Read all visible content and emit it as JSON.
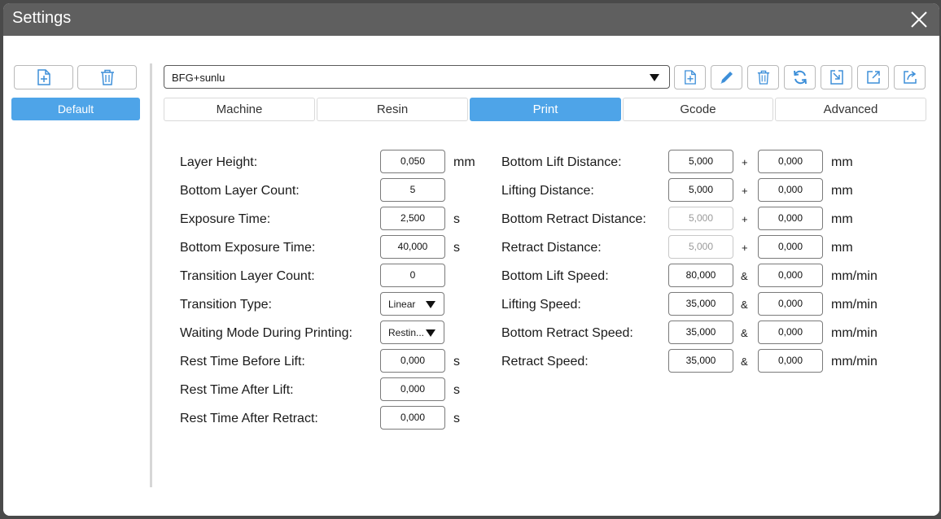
{
  "window": {
    "title": "Settings"
  },
  "profiles": {
    "items": [
      "Default"
    ]
  },
  "machine_dropdown": {
    "value": "BFG+sunlu"
  },
  "tabs": [
    {
      "label": "Machine",
      "active": false
    },
    {
      "label": "Resin",
      "active": false
    },
    {
      "label": "Print",
      "active": true
    },
    {
      "label": "Gcode",
      "active": false
    },
    {
      "label": "Advanced",
      "active": false
    }
  ],
  "left_fields": [
    {
      "label": "Layer Height:",
      "value": "0,050",
      "unit": "mm"
    },
    {
      "label": "Bottom Layer Count:",
      "value": "5",
      "unit": ""
    },
    {
      "label": "Exposure Time:",
      "value": "2,500",
      "unit": "s"
    },
    {
      "label": "Bottom Exposure Time:",
      "value": "40,000",
      "unit": "s"
    },
    {
      "label": "Transition Layer Count:",
      "value": "0",
      "unit": ""
    },
    {
      "label": "Transition Type:",
      "value": "Linear",
      "unit": ""
    },
    {
      "label": "Waiting Mode During Printing:",
      "value": "Restin...",
      "unit": ""
    },
    {
      "label": "Rest Time Before Lift:",
      "value": "0,000",
      "unit": "s"
    },
    {
      "label": "Rest Time After Lift:",
      "value": "0,000",
      "unit": "s"
    },
    {
      "label": "Rest Time After Retract:",
      "value": "0,000",
      "unit": "s"
    }
  ],
  "right_fields": [
    {
      "label": "Bottom Lift Distance:",
      "value1": "5,000",
      "sep": "+",
      "value2": "0,000",
      "unit": "mm"
    },
    {
      "label": "Lifting Distance:",
      "value1": "5,000",
      "sep": "+",
      "value2": "0,000",
      "unit": "mm"
    },
    {
      "label": "Bottom Retract Distance:",
      "value1": "5,000",
      "sep": "+",
      "value2": "0,000",
      "unit": "mm"
    },
    {
      "label": "Retract Distance:",
      "value1": "5,000",
      "sep": "+",
      "value2": "0,000",
      "unit": "mm"
    },
    {
      "label": "Bottom Lift Speed:",
      "value1": "80,000",
      "sep": "&",
      "value2": "0,000",
      "unit": "mm/min"
    },
    {
      "label": "Lifting Speed:",
      "value1": "35,000",
      "sep": "&",
      "value2": "0,000",
      "unit": "mm/min"
    },
    {
      "label": "Bottom Retract Speed:",
      "value1": "35,000",
      "sep": "&",
      "value2": "0,000",
      "unit": "mm/min"
    },
    {
      "label": "Retract Speed:",
      "value1": "35,000",
      "sep": "&",
      "value2": "0,000",
      "unit": "mm/min"
    }
  ],
  "colors": {
    "accent": "#4ea4e8",
    "titlebar": "#5f5f5f",
    "icon": "#3d8fd9"
  },
  "icons": {
    "left_toolbar": [
      "file-add-icon",
      "trash-icon"
    ],
    "right_toolbar": [
      "file-add-icon",
      "pencil-icon",
      "trash-icon",
      "refresh-icon",
      "import-icon",
      "export-icon",
      "share-icon"
    ],
    "close": "close-icon"
  }
}
